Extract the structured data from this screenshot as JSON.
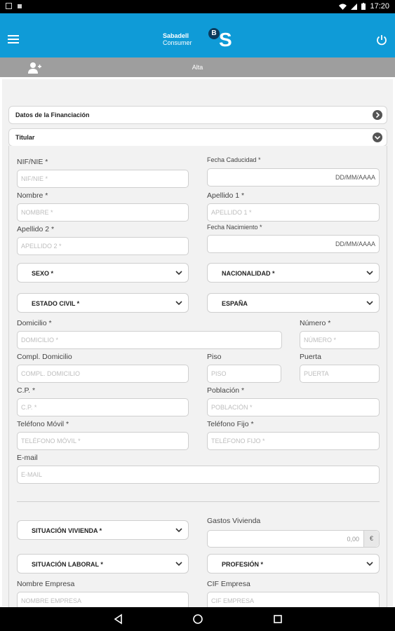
{
  "status_bar": {
    "time": "17:20"
  },
  "app_bar": {
    "brand_line1": "Sabadell",
    "brand_line2": "Consumer",
    "brand_mark": "B",
    "brand_letter": "S",
    "menu_icon": "menu-icon",
    "power_icon": "power-icon",
    "accent_color": "#0f9bd7"
  },
  "sub_bar": {
    "title": "Alta",
    "icon": "add-user-icon"
  },
  "sections": {
    "financiacion": {
      "label": "Datos de la Financiación"
    },
    "titular": {
      "label": "Titular"
    }
  },
  "form": {
    "nif": {
      "label": "NIF/NIE *",
      "placeholder": "NIF/NIE *"
    },
    "fecha_caducidad": {
      "label": "Fecha Caducidad *",
      "placeholder": "DD/MM/AAAA"
    },
    "nombre": {
      "label": "Nombre *",
      "placeholder": "NOMBRE *"
    },
    "apellido1": {
      "label": "Apellido 1 *",
      "placeholder": "APELLIDO 1 *"
    },
    "apellido2": {
      "label": "Apellido 2 *",
      "placeholder": "APELLIDO 2 *"
    },
    "fecha_nacimiento": {
      "label": "Fecha Nacimiento *",
      "placeholder": "DD/MM/AAAA"
    },
    "sexo": {
      "value": "SEXO *"
    },
    "nacionalidad": {
      "value": "NACIONALIDAD *"
    },
    "estado_civil": {
      "value": "ESTADO CIVIL *"
    },
    "pais": {
      "value": "ESPAÑA"
    },
    "domicilio": {
      "label": "Domicilio *",
      "placeholder": "DOMICILIO *"
    },
    "numero": {
      "label": "Número *",
      "placeholder": "NÚMERO *"
    },
    "compl_domicilio": {
      "label": "Compl. Domicilio",
      "placeholder": "COMPL. DOMICILIO"
    },
    "piso": {
      "label": "Piso",
      "placeholder": "PISO"
    },
    "puerta": {
      "label": "Puerta",
      "placeholder": "PUERTA"
    },
    "cp": {
      "label": "C.P. *",
      "placeholder": "C.P. *"
    },
    "poblacion": {
      "label": "Población *",
      "placeholder": "POBLACIÓN *"
    },
    "telefono_movil": {
      "label": "Teléfono Móvil *",
      "placeholder": "TELÉFONO MÓVIL *"
    },
    "telefono_fijo": {
      "label": "Teléfono Fijo *",
      "placeholder": "TELÉFONO FIJO *"
    },
    "email": {
      "label": "E-mail",
      "placeholder": "E-MAIL"
    },
    "situacion_vivienda": {
      "value": "SITUACIÓN VIVIENDA *"
    },
    "gastos_vivienda": {
      "label": "Gastos Vivienda",
      "value": "0,00",
      "currency": "€"
    },
    "situacion_laboral": {
      "value": "SITUACIÓN LABORAL *"
    },
    "profesion": {
      "value": "PROFESIÓN *"
    },
    "nombre_empresa": {
      "label": "Nombre Empresa",
      "placeholder": "NOMBRE EMPRESA"
    },
    "cif_empresa": {
      "label": "CIF Empresa",
      "placeholder": "CIF EMPRESA"
    }
  },
  "nav_bar": {
    "back": "back-icon",
    "home": "home-icon",
    "recents": "recents-icon"
  }
}
